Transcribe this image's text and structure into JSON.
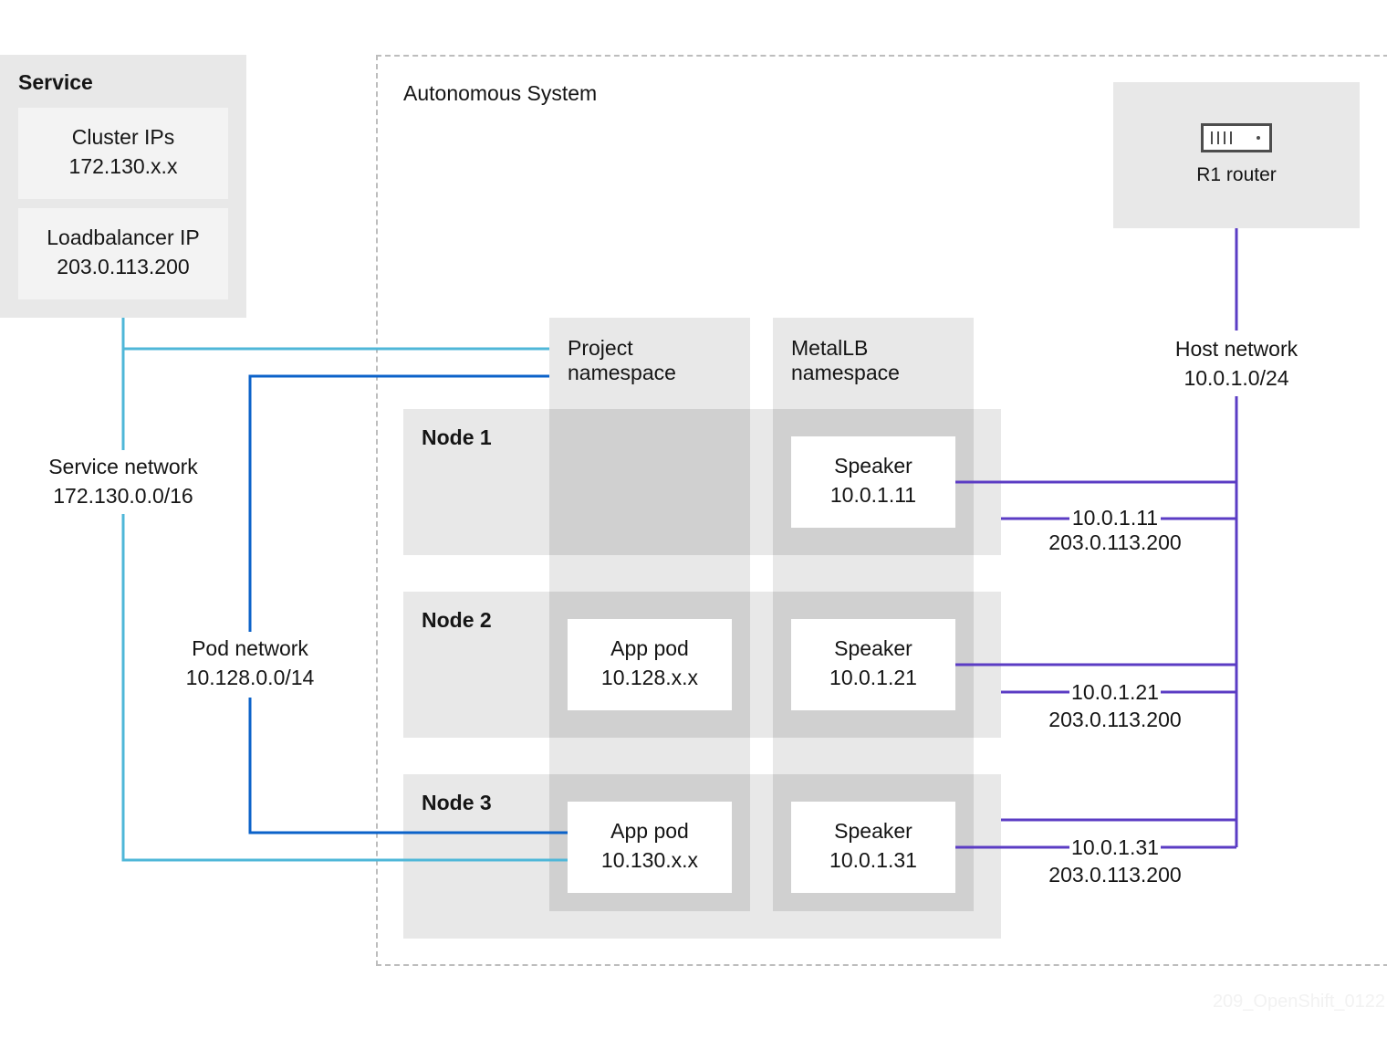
{
  "service": {
    "title": "Service",
    "cluster_ips": {
      "label": "Cluster IPs",
      "value": "172.130.x.x"
    },
    "loadbalancer_ip": {
      "label": "Loadbalancer IP",
      "value": "203.0.113.200"
    }
  },
  "autonomous_system": {
    "title": "Autonomous System"
  },
  "router": {
    "label": "R1 router",
    "icon": "router-icon"
  },
  "networks": {
    "service": {
      "label": "Service network",
      "cidr": "172.130.0.0/16",
      "color": "#4FB7D8"
    },
    "pod": {
      "label": "Pod network",
      "cidr": "10.128.0.0/14",
      "color": "#0B62C9"
    },
    "host": {
      "label": "Host network",
      "cidr": "10.0.1.0/24",
      "color": "#5B3CC4"
    }
  },
  "namespaces": {
    "project": {
      "line1": "Project",
      "line2": "namespace"
    },
    "metallb": {
      "line1": "MetalLB",
      "line2": "namespace"
    }
  },
  "nodes": [
    {
      "label": "Node 1",
      "app_pod": null,
      "speaker": {
        "label": "Speaker",
        "ip": "10.0.1.11"
      },
      "route": {
        "next_hop": "10.0.1.11",
        "prefix": "203.0.113.200"
      }
    },
    {
      "label": "Node 2",
      "app_pod": {
        "label": "App pod",
        "ip": "10.128.x.x"
      },
      "speaker": {
        "label": "Speaker",
        "ip": "10.0.1.21"
      },
      "route": {
        "next_hop": "10.0.1.21",
        "prefix": "203.0.113.200"
      }
    },
    {
      "label": "Node 3",
      "app_pod": {
        "label": "App pod",
        "ip": "10.130.x.x"
      },
      "speaker": {
        "label": "Speaker",
        "ip": "10.0.1.31"
      },
      "route": {
        "next_hop": "10.0.1.31",
        "prefix": "203.0.113.200"
      }
    }
  ],
  "watermark": "209_OpenShift_0122"
}
